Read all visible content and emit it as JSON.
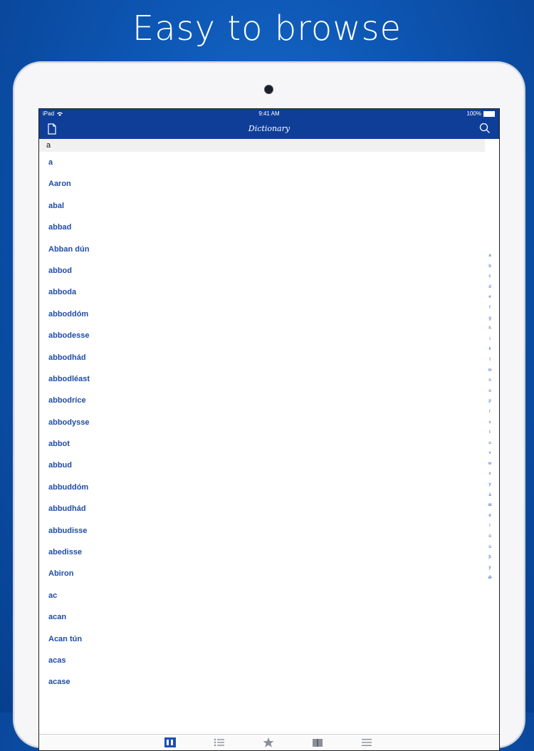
{
  "headline": "Easy to browse",
  "status_bar": {
    "device": "iPad",
    "time": "9:41 AM",
    "battery": "100%"
  },
  "nav": {
    "title": "Dictionary"
  },
  "section_header": "a",
  "entries": [
    "a",
    "Aaron",
    "abal",
    "abbad",
    "Abban dún",
    "abbod",
    "abboda",
    "abboddóm",
    "abbodesse",
    "abbodhád",
    "abbodléast",
    "abbodríce",
    "abbodysse",
    "abbot",
    "abbud",
    "abbuddóm",
    "abbudhád",
    "abbudisse",
    "abedisse",
    "Abiron",
    "ac",
    "acan",
    "Acan tún",
    "acas",
    "acase"
  ],
  "index_letters": [
    "a",
    "b",
    "c",
    "d",
    "e",
    "f",
    "g",
    "h",
    "i",
    "k",
    "l",
    "m",
    "n",
    "o",
    "p",
    "r",
    "s",
    "t",
    "u",
    "v",
    "w",
    "x",
    "y",
    "á",
    "æ",
    "é",
    "í",
    "ó",
    "ú",
    "þ",
    "ý",
    "ǽ"
  ],
  "colors": {
    "bar_blue": "#0f3e98",
    "entry_blue": "#1f4ca8",
    "active_tab": "#1d4fb3",
    "inactive_tab": "#8a8f99"
  },
  "tabs": [
    "browse-icon",
    "list-icon",
    "star-icon",
    "book-icon",
    "menu-icon"
  ]
}
